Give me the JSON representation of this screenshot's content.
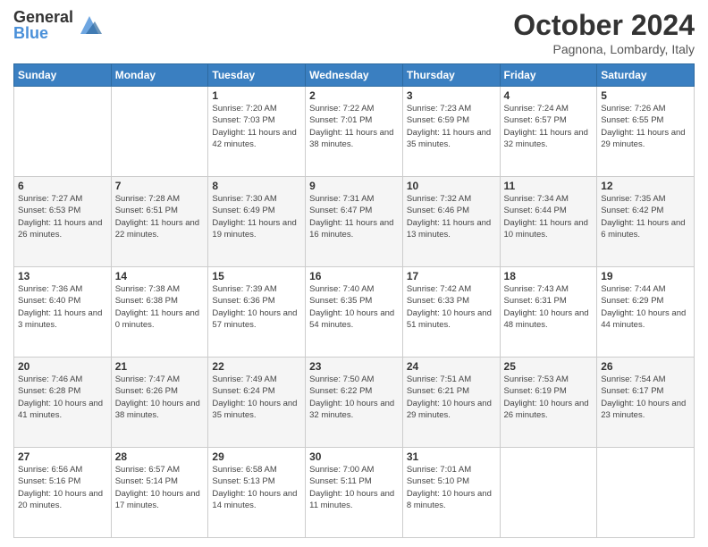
{
  "header": {
    "logo_general": "General",
    "logo_blue": "Blue",
    "month_title": "October 2024",
    "location": "Pagnona, Lombardy, Italy"
  },
  "weekdays": [
    "Sunday",
    "Monday",
    "Tuesday",
    "Wednesday",
    "Thursday",
    "Friday",
    "Saturday"
  ],
  "weeks": [
    [
      {
        "day": "",
        "info": ""
      },
      {
        "day": "",
        "info": ""
      },
      {
        "day": "1",
        "info": "Sunrise: 7:20 AM\nSunset: 7:03 PM\nDaylight: 11 hours and 42 minutes."
      },
      {
        "day": "2",
        "info": "Sunrise: 7:22 AM\nSunset: 7:01 PM\nDaylight: 11 hours and 38 minutes."
      },
      {
        "day": "3",
        "info": "Sunrise: 7:23 AM\nSunset: 6:59 PM\nDaylight: 11 hours and 35 minutes."
      },
      {
        "day": "4",
        "info": "Sunrise: 7:24 AM\nSunset: 6:57 PM\nDaylight: 11 hours and 32 minutes."
      },
      {
        "day": "5",
        "info": "Sunrise: 7:26 AM\nSunset: 6:55 PM\nDaylight: 11 hours and 29 minutes."
      }
    ],
    [
      {
        "day": "6",
        "info": "Sunrise: 7:27 AM\nSunset: 6:53 PM\nDaylight: 11 hours and 26 minutes."
      },
      {
        "day": "7",
        "info": "Sunrise: 7:28 AM\nSunset: 6:51 PM\nDaylight: 11 hours and 22 minutes."
      },
      {
        "day": "8",
        "info": "Sunrise: 7:30 AM\nSunset: 6:49 PM\nDaylight: 11 hours and 19 minutes."
      },
      {
        "day": "9",
        "info": "Sunrise: 7:31 AM\nSunset: 6:47 PM\nDaylight: 11 hours and 16 minutes."
      },
      {
        "day": "10",
        "info": "Sunrise: 7:32 AM\nSunset: 6:46 PM\nDaylight: 11 hours and 13 minutes."
      },
      {
        "day": "11",
        "info": "Sunrise: 7:34 AM\nSunset: 6:44 PM\nDaylight: 11 hours and 10 minutes."
      },
      {
        "day": "12",
        "info": "Sunrise: 7:35 AM\nSunset: 6:42 PM\nDaylight: 11 hours and 6 minutes."
      }
    ],
    [
      {
        "day": "13",
        "info": "Sunrise: 7:36 AM\nSunset: 6:40 PM\nDaylight: 11 hours and 3 minutes."
      },
      {
        "day": "14",
        "info": "Sunrise: 7:38 AM\nSunset: 6:38 PM\nDaylight: 11 hours and 0 minutes."
      },
      {
        "day": "15",
        "info": "Sunrise: 7:39 AM\nSunset: 6:36 PM\nDaylight: 10 hours and 57 minutes."
      },
      {
        "day": "16",
        "info": "Sunrise: 7:40 AM\nSunset: 6:35 PM\nDaylight: 10 hours and 54 minutes."
      },
      {
        "day": "17",
        "info": "Sunrise: 7:42 AM\nSunset: 6:33 PM\nDaylight: 10 hours and 51 minutes."
      },
      {
        "day": "18",
        "info": "Sunrise: 7:43 AM\nSunset: 6:31 PM\nDaylight: 10 hours and 48 minutes."
      },
      {
        "day": "19",
        "info": "Sunrise: 7:44 AM\nSunset: 6:29 PM\nDaylight: 10 hours and 44 minutes."
      }
    ],
    [
      {
        "day": "20",
        "info": "Sunrise: 7:46 AM\nSunset: 6:28 PM\nDaylight: 10 hours and 41 minutes."
      },
      {
        "day": "21",
        "info": "Sunrise: 7:47 AM\nSunset: 6:26 PM\nDaylight: 10 hours and 38 minutes."
      },
      {
        "day": "22",
        "info": "Sunrise: 7:49 AM\nSunset: 6:24 PM\nDaylight: 10 hours and 35 minutes."
      },
      {
        "day": "23",
        "info": "Sunrise: 7:50 AM\nSunset: 6:22 PM\nDaylight: 10 hours and 32 minutes."
      },
      {
        "day": "24",
        "info": "Sunrise: 7:51 AM\nSunset: 6:21 PM\nDaylight: 10 hours and 29 minutes."
      },
      {
        "day": "25",
        "info": "Sunrise: 7:53 AM\nSunset: 6:19 PM\nDaylight: 10 hours and 26 minutes."
      },
      {
        "day": "26",
        "info": "Sunrise: 7:54 AM\nSunset: 6:17 PM\nDaylight: 10 hours and 23 minutes."
      }
    ],
    [
      {
        "day": "27",
        "info": "Sunrise: 6:56 AM\nSunset: 5:16 PM\nDaylight: 10 hours and 20 minutes."
      },
      {
        "day": "28",
        "info": "Sunrise: 6:57 AM\nSunset: 5:14 PM\nDaylight: 10 hours and 17 minutes."
      },
      {
        "day": "29",
        "info": "Sunrise: 6:58 AM\nSunset: 5:13 PM\nDaylight: 10 hours and 14 minutes."
      },
      {
        "day": "30",
        "info": "Sunrise: 7:00 AM\nSunset: 5:11 PM\nDaylight: 10 hours and 11 minutes."
      },
      {
        "day": "31",
        "info": "Sunrise: 7:01 AM\nSunset: 5:10 PM\nDaylight: 10 hours and 8 minutes."
      },
      {
        "day": "",
        "info": ""
      },
      {
        "day": "",
        "info": ""
      }
    ]
  ]
}
